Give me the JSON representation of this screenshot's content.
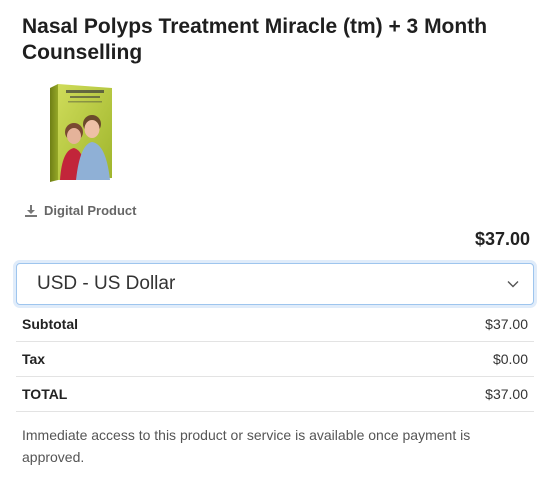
{
  "product": {
    "title": "Nasal Polyps Treatment Miracle (tm) + 3 Month Counselling",
    "image_icon": "ebook-cover-image",
    "type_icon": "download-icon",
    "type_label": "Digital Product",
    "price": "$37.00"
  },
  "currency": {
    "selected": "USD - US Dollar",
    "chevron_icon": "chevron-down-icon"
  },
  "totals": [
    {
      "label": "Subtotal",
      "amount": "$37.00"
    },
    {
      "label": "Tax",
      "amount": "$0.00"
    },
    {
      "label": "TOTAL",
      "amount": "$37.00"
    }
  ],
  "note": "Immediate access to this product or service is available once payment is approved.",
  "colors": {
    "select_border": "#9ec5ee",
    "cover_green": "#b6c93a",
    "muted_text": "#666666"
  }
}
